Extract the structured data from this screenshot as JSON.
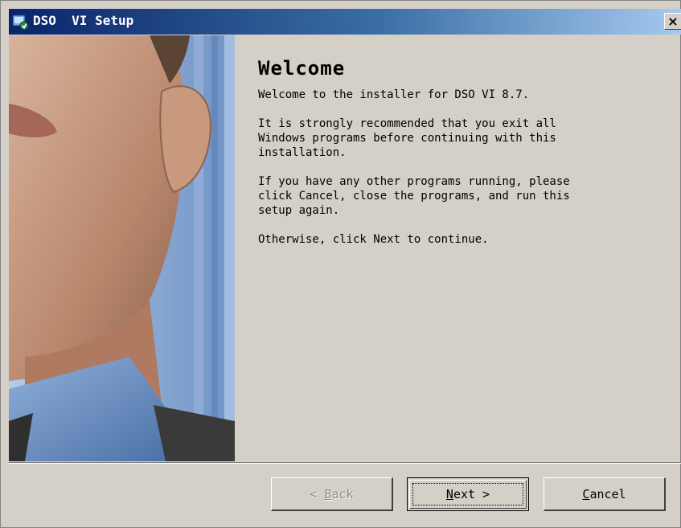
{
  "window": {
    "title": "DSO  VI Setup",
    "close_label": "×"
  },
  "content": {
    "heading": "Welcome",
    "paragraphs": [
      "Welcome to the installer for DSO  VI 8.7.",
      "It is strongly recommended that you exit all\nWindows programs before continuing with this\ninstallation.",
      "If you have any other programs running, please\nclick Cancel, close the programs, and run this\nsetup again.",
      "Otherwise, click Next to continue."
    ]
  },
  "buttons": {
    "back": {
      "prefix": "< ",
      "mnemonic": "B",
      "rest": "ack",
      "enabled": false
    },
    "next": {
      "mnemonic": "N",
      "rest": "ext >",
      "enabled": true,
      "default": true
    },
    "cancel": {
      "mnemonic": "C",
      "rest": "ancel",
      "enabled": true
    }
  },
  "icons": {
    "title": "setup-installer-icon",
    "close": "close-icon"
  }
}
